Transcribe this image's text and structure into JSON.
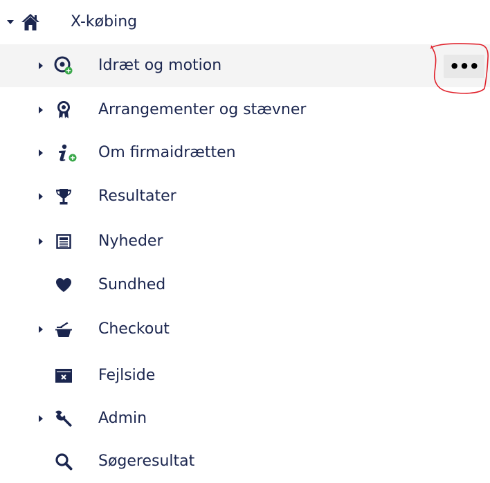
{
  "tree": {
    "root": {
      "label": "X-købing",
      "icon": "home-icon",
      "expanded": true
    },
    "items": [
      {
        "label": "Idræt og motion",
        "icon": "sport-ball-plus-icon",
        "has_children": true,
        "selected": true
      },
      {
        "label": "Arrangementer og stævner",
        "icon": "award-ribbon-icon",
        "has_children": true
      },
      {
        "label": "Om firmaidrætten",
        "icon": "info-plus-icon",
        "has_children": true
      },
      {
        "label": "Resultater",
        "icon": "trophy-icon",
        "has_children": true
      },
      {
        "label": "Nyheder",
        "icon": "newspaper-icon",
        "has_children": true
      },
      {
        "label": "Sundhed",
        "icon": "heart-icon",
        "has_children": false
      },
      {
        "label": "Checkout",
        "icon": "basket-icon",
        "has_children": true
      },
      {
        "label": "Fejlside",
        "icon": "error-window-icon",
        "has_children": false
      },
      {
        "label": "Admin",
        "icon": "wrench-icon",
        "has_children": true
      },
      {
        "label": "Søgeresultat",
        "icon": "search-icon",
        "has_children": false
      }
    ],
    "actions_button": {
      "label": "•••",
      "icon": "more-actions-icon"
    }
  },
  "colors": {
    "text": "#1b264f",
    "selected_bg": "#f4f4f4",
    "button_bg": "#e8e8e8",
    "annotation": "#e0202a",
    "badge_green": "#3aa84a"
  }
}
